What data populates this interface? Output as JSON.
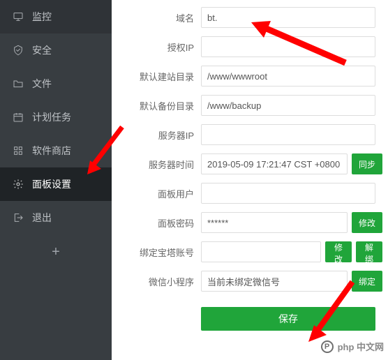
{
  "sidebar": {
    "items": [
      {
        "label": "监控",
        "icon": "monitor-icon"
      },
      {
        "label": "安全",
        "icon": "shield-icon"
      },
      {
        "label": "文件",
        "icon": "folder-icon"
      },
      {
        "label": "计划任务",
        "icon": "calendar-icon"
      },
      {
        "label": "软件商店",
        "icon": "apps-icon"
      },
      {
        "label": "面板设置",
        "icon": "gear-icon",
        "active": true
      },
      {
        "label": "退出",
        "icon": "exit-icon"
      }
    ]
  },
  "form": {
    "domain": {
      "label": "域名",
      "value": "bt."
    },
    "auth_ip": {
      "label": "授权IP",
      "value": ""
    },
    "site_dir": {
      "label": "默认建站目录",
      "value": "/www/wwwroot"
    },
    "backup_dir": {
      "label": "默认备份目录",
      "value": "/www/backup"
    },
    "server_ip": {
      "label": "服务器IP",
      "value": ""
    },
    "server_time": {
      "label": "服务器时间",
      "value": "2019-05-09 17:21:47 CST +0800",
      "action": "同步"
    },
    "panel_user": {
      "label": "面板用户",
      "value": ""
    },
    "panel_pass": {
      "label": "面板密码",
      "value": "******",
      "action": "修改"
    },
    "bt_account": {
      "label": "绑定宝塔账号",
      "value": "",
      "action1": "修改",
      "action2": "解绑"
    },
    "wx_miniapp": {
      "label": "微信小程序",
      "value": "当前未绑定微信号",
      "action": "绑定"
    },
    "save": "保存"
  },
  "watermark": "php 中文网"
}
